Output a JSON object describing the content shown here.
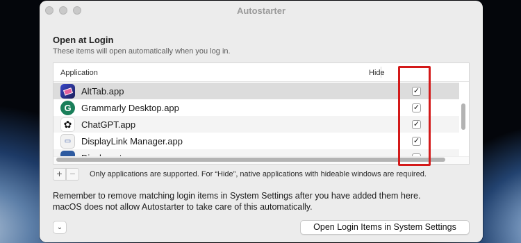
{
  "window": {
    "title": "Autostarter"
  },
  "section": {
    "title": "Open at Login",
    "subtitle": "These items will open automatically when you log in."
  },
  "table": {
    "columns": [
      "Application",
      "Hide"
    ],
    "rows": [
      {
        "name": "AltTab.app",
        "icon": "alttab-icon",
        "hide": true,
        "selected": true
      },
      {
        "name": "Grammarly Desktop.app",
        "icon": "grammarly-icon",
        "hide": true
      },
      {
        "name": "ChatGPT.app",
        "icon": "chatgpt-icon",
        "hide": true
      },
      {
        "name": "DisplayLink Manager.app",
        "icon": "displaylink-icon",
        "hide": true
      },
      {
        "name": "Displaperture...",
        "icon": "app-icon",
        "hide": true,
        "partial": true
      }
    ]
  },
  "controls": {
    "add_label": "+",
    "remove_label": "−",
    "note": "Only applications are supported. For “Hide”, native applications with hideable windows are required."
  },
  "remember": {
    "line1": "Remember to remove matching login items in System Settings after you have added them here.",
    "line2": "macOS does not allow Autostarter to take care of this automatically."
  },
  "footer": {
    "expand_label": "⌄",
    "open_settings_label": "Open Login Items in System Settings"
  },
  "colors": {
    "highlight": "#d31919",
    "window_bg": "#ececec"
  }
}
